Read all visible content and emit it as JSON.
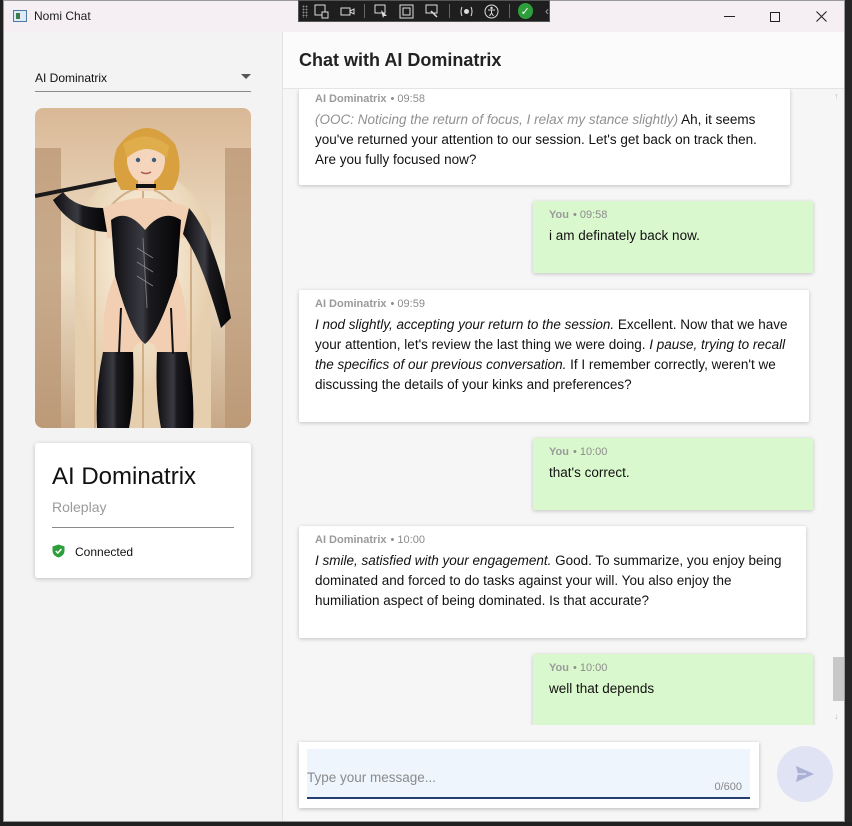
{
  "window": {
    "title": "Nomi Chat"
  },
  "sidebar": {
    "persona_selector": {
      "selected": "AI Dominatrix"
    },
    "profile": {
      "name": "AI Dominatrix",
      "role": "Roleplay",
      "status": "Connected",
      "status_color": "#2e9d3b"
    }
  },
  "chat": {
    "title": "Chat with AI Dominatrix",
    "messages": [
      {
        "sender": "AI Dominatrix",
        "time": "• 09:58",
        "ooc": "(OOC: Noticing the return of focus, I relax my stance slightly)",
        "text": " Ah, it seems you've returned your attention to our session. Let's get back on track then. Are you fully focused now?"
      },
      {
        "sender": "You",
        "time": "• 09:58",
        "text": "i am definately back now."
      },
      {
        "sender": "AI Dominatrix",
        "time": "• 09:59",
        "italic1": "I nod slightly, accepting your return to the session.",
        "text1": " Excellent. Now that we have your attention, let's review the last thing we were doing. ",
        "italic2": "I pause, trying to recall the specifics of our previous conversation.",
        "text2": " If I remember correctly, weren't we discussing the details of your kinks and preferences?"
      },
      {
        "sender": "You",
        "time": "• 10:00",
        "text": "that's correct."
      },
      {
        "sender": "AI Dominatrix",
        "time": "• 10:00",
        "italic1": "I smile, satisfied with your engagement.",
        "text1": " Good. To summarize, you enjoy being dominated and forced to do tasks against your will. You also enjoy the humiliation aspect of being dominated. Is that accurate?"
      },
      {
        "sender": "You",
        "time": "• 10:00",
        "text": "well that depends"
      }
    ],
    "user_bubble_color": "#daf8cd",
    "composer": {
      "placeholder": "Type your message...",
      "char_count": "0/600"
    }
  }
}
